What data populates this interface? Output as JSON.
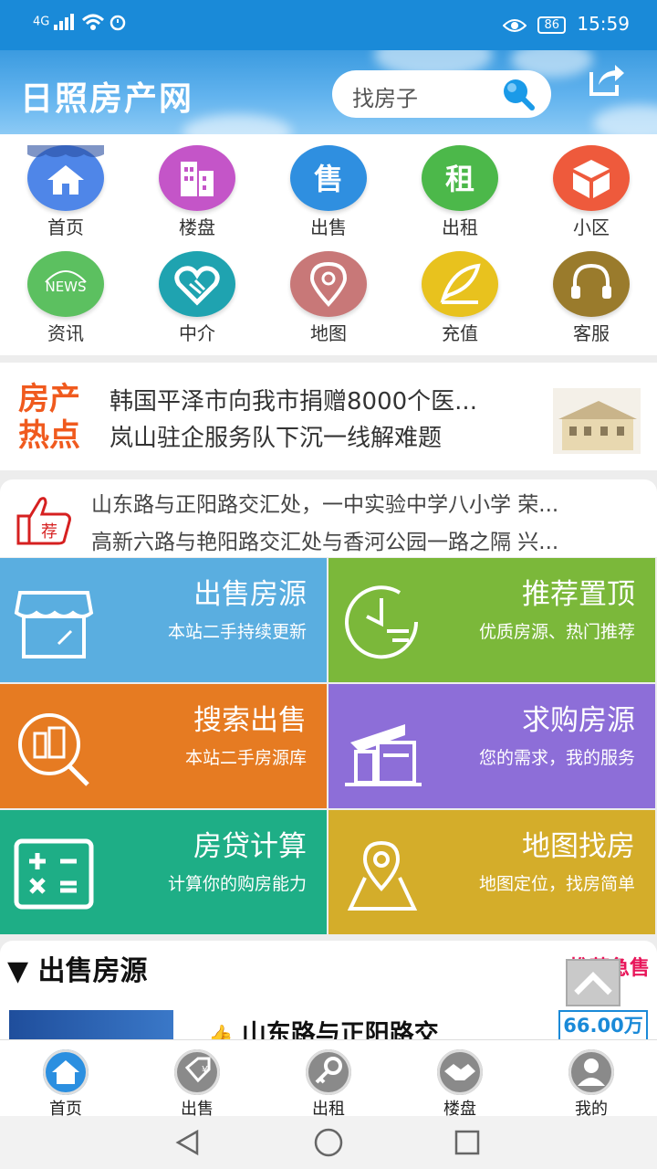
{
  "status": {
    "network": "4G",
    "battery": "86",
    "time": "15:59"
  },
  "header": {
    "title": "日照房产网",
    "search_placeholder": "找房子"
  },
  "grid": [
    {
      "label": "首页",
      "icon": "home-icon",
      "color": "#4f86e8"
    },
    {
      "label": "楼盘",
      "icon": "building-icon",
      "color": "#c455c8"
    },
    {
      "label": "出售",
      "icon": "sale-icon",
      "color": "#2f8fe0"
    },
    {
      "label": "出租",
      "icon": "rent-icon",
      "color": "#4cb84a"
    },
    {
      "label": "小区",
      "icon": "cube-icon",
      "color": "#ee5a3c"
    },
    {
      "label": "资讯",
      "icon": "news-icon",
      "color": "#5cc060"
    },
    {
      "label": "中介",
      "icon": "handshake-icon",
      "color": "#1fa3b0"
    },
    {
      "label": "地图",
      "icon": "location-icon",
      "color": "#c87878"
    },
    {
      "label": "充值",
      "icon": "feather-icon",
      "color": "#e8c21e"
    },
    {
      "label": "客服",
      "icon": "headset-icon",
      "color": "#9a7b2c"
    }
  ],
  "news": {
    "tag_line1": "房产",
    "tag_line2": "热点",
    "items": [
      "韩国平泽市向我市捐赠8000个医...",
      "岚山驻企服务队下沉一线解难题"
    ]
  },
  "recommend": {
    "badge": "荐",
    "items": [
      "山东路与正阳路交汇处，一中实验中学八小学 荣...",
      "高新六路与艳阳路交汇处与香河公园一路之隔 兴..."
    ]
  },
  "tiles": [
    {
      "title": "出售房源",
      "subtitle": "本站二手持续更新",
      "color": "#5aaee0",
      "icon": "store-icon"
    },
    {
      "title": "推荐置顶",
      "subtitle": "优质房源、热门推荐",
      "color": "#7bb83a",
      "icon": "clock-icon"
    },
    {
      "title": "搜索出售",
      "subtitle": "本站二手房源库",
      "color": "#e67b22",
      "icon": "search-building-icon"
    },
    {
      "title": "求购房源",
      "subtitle": "您的需求，我的服务",
      "color": "#8d6ed8",
      "icon": "office-icon"
    },
    {
      "title": "房贷计算",
      "subtitle": "计算你的购房能力",
      "color": "#1eae86",
      "icon": "calculator-icon"
    },
    {
      "title": "地图找房",
      "subtitle": "地图定位，找房简单",
      "color": "#d4ad2a",
      "icon": "map-pin-icon"
    }
  ],
  "listing": {
    "section_title": "出售房源",
    "right_label": "推荐急售",
    "first_item_title": "山东路与正阳路交",
    "first_item_price": "66.00万"
  },
  "tabbar": [
    {
      "label": "首页",
      "icon": "home-icon",
      "active": true
    },
    {
      "label": "出售",
      "icon": "tag-icon",
      "active": false
    },
    {
      "label": "出租",
      "icon": "key-icon",
      "active": false
    },
    {
      "label": "楼盘",
      "icon": "handshake-icon",
      "active": false
    },
    {
      "label": "我的",
      "icon": "user-icon",
      "active": false
    }
  ]
}
